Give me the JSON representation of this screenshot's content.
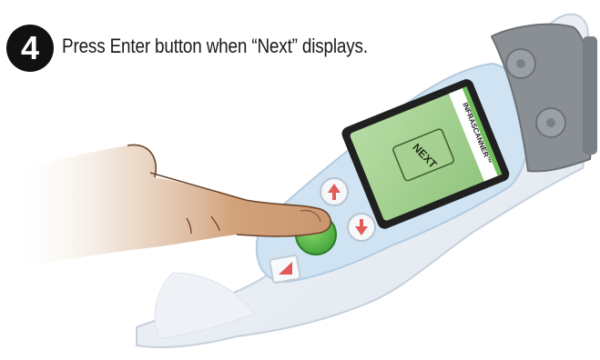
{
  "step": {
    "number": "4",
    "instruction": "Press Enter button when “Next” displays."
  },
  "device": {
    "brand": "INFRASCANNER™",
    "screen_text": "NEXT",
    "body_color": "#e9eff5",
    "panel_color": "#cfe3f3",
    "screen_color": "#9fd08c",
    "brand_stripe_color": "#6fbf5a",
    "enter_button_color": "#4cb648"
  },
  "icons": {
    "up_button": "arrow-up-icon",
    "down_button": "arrow-down-icon",
    "enter_button": "enter-button-icon",
    "left_button": "triangle-icon"
  }
}
